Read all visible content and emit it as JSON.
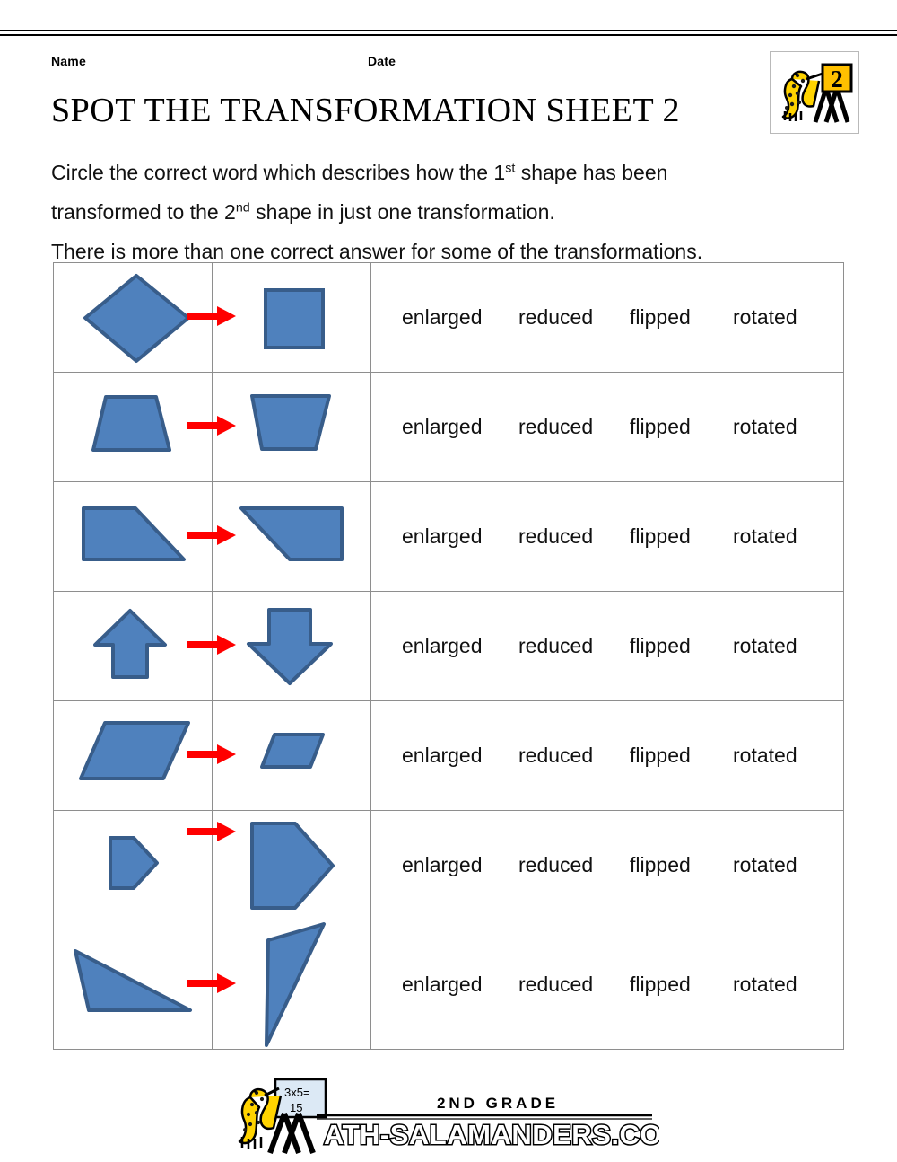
{
  "page": {
    "name_label": "Name",
    "date_label": "Date",
    "title": "SPOT THE TRANSFORMATION SHEET 2"
  },
  "instructions": {
    "line1_a": "Circle the correct word which describes how the 1",
    "line1_sup": "st",
    "line1_b": " shape has been",
    "line2_a": "transformed to the 2",
    "line2_sup": "nd",
    "line2_b": " shape in just one transformation.",
    "line3": "There is more than one correct answer for some of the transformations."
  },
  "header_logo": {
    "alt": "math-salamanders-grade-2-logo",
    "sign_number": "2",
    "body_color": "#FFD300",
    "spot_color": "#1a1a1a"
  },
  "colors": {
    "shape_fill": "#4f81bd",
    "shape_stroke": "#385d8a",
    "arrow": "#FF0000",
    "table_border": "#8e8e8e",
    "text": "#111111"
  },
  "answer_options": [
    "enlarged",
    "reduced",
    "flipped",
    "rotated"
  ],
  "rows": [
    {
      "index": 1,
      "shape1": "diamond-large",
      "shape2": "square-small",
      "answers": [
        "enlarged",
        "reduced",
        "flipped",
        "rotated"
      ]
    },
    {
      "index": 2,
      "shape1": "trapezoid-narrow-top",
      "shape2": "trapezoid-flipped",
      "answers": [
        "enlarged",
        "reduced",
        "flipped",
        "rotated"
      ]
    },
    {
      "index": 3,
      "shape1": "right-trapezoid-left",
      "shape2": "right-trapezoid-mirrored",
      "answers": [
        "enlarged",
        "reduced",
        "flipped",
        "rotated"
      ]
    },
    {
      "index": 4,
      "shape1": "arrow-up",
      "shape2": "arrow-down-large",
      "answers": [
        "enlarged",
        "reduced",
        "flipped",
        "rotated"
      ]
    },
    {
      "index": 5,
      "shape1": "parallelogram-large",
      "shape2": "parallelogram-small",
      "answers": [
        "enlarged",
        "reduced",
        "flipped",
        "rotated"
      ]
    },
    {
      "index": 6,
      "shape1": "pentagon-small-right",
      "shape2": "pentagon-large-right",
      "answers": [
        "enlarged",
        "reduced",
        "flipped",
        "rotated"
      ]
    },
    {
      "index": 7,
      "shape1": "triangle-horizontal",
      "shape2": "triangle-vertical",
      "answers": [
        "enlarged",
        "reduced",
        "flipped",
        "rotated"
      ]
    }
  ],
  "footer": {
    "grade_text": "2ND GRADE",
    "site_text": "MATH-SALAMANDERS.COM",
    "board_text_top": "3x5=",
    "board_text_bottom": "15"
  }
}
